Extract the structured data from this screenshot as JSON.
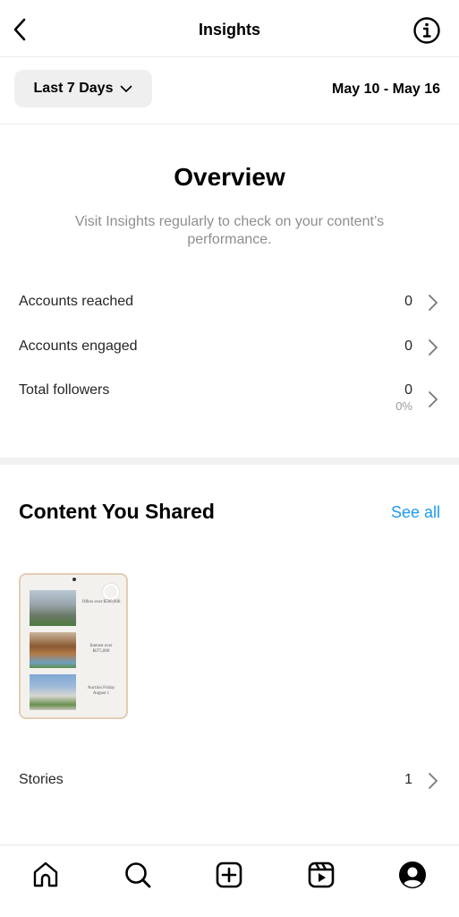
{
  "header": {
    "title": "Insights",
    "back_icon": "chevron-left-icon",
    "info_icon": "info-circle-icon"
  },
  "filter": {
    "period_label": "Last 7 Days",
    "period_icon": "chevron-down-icon",
    "date_range": "May 10 - May 16"
  },
  "overview": {
    "title": "Overview",
    "description": "Visit Insights regularly to check on your content’s performance.",
    "metrics": [
      {
        "label": "Accounts reached",
        "value": "0"
      },
      {
        "label": "Accounts engaged",
        "value": "0"
      },
      {
        "label": "Total followers",
        "value": "0",
        "sub": "0%"
      }
    ]
  },
  "content": {
    "title": "Content You Shared",
    "see_all": "See all",
    "thumbnail_captions": [
      "Offers over $500,000",
      "Interest over $675,000",
      "Auction Friday August 1"
    ],
    "stories": {
      "label": "Stories",
      "value": "1"
    }
  },
  "accent_color": "#1d9bf0",
  "bottom_nav": [
    {
      "name": "home",
      "icon": "home-icon"
    },
    {
      "name": "search",
      "icon": "search-icon"
    },
    {
      "name": "create",
      "icon": "plus-square-icon"
    },
    {
      "name": "reels",
      "icon": "reels-icon"
    },
    {
      "name": "profile",
      "icon": "profile-icon"
    }
  ]
}
